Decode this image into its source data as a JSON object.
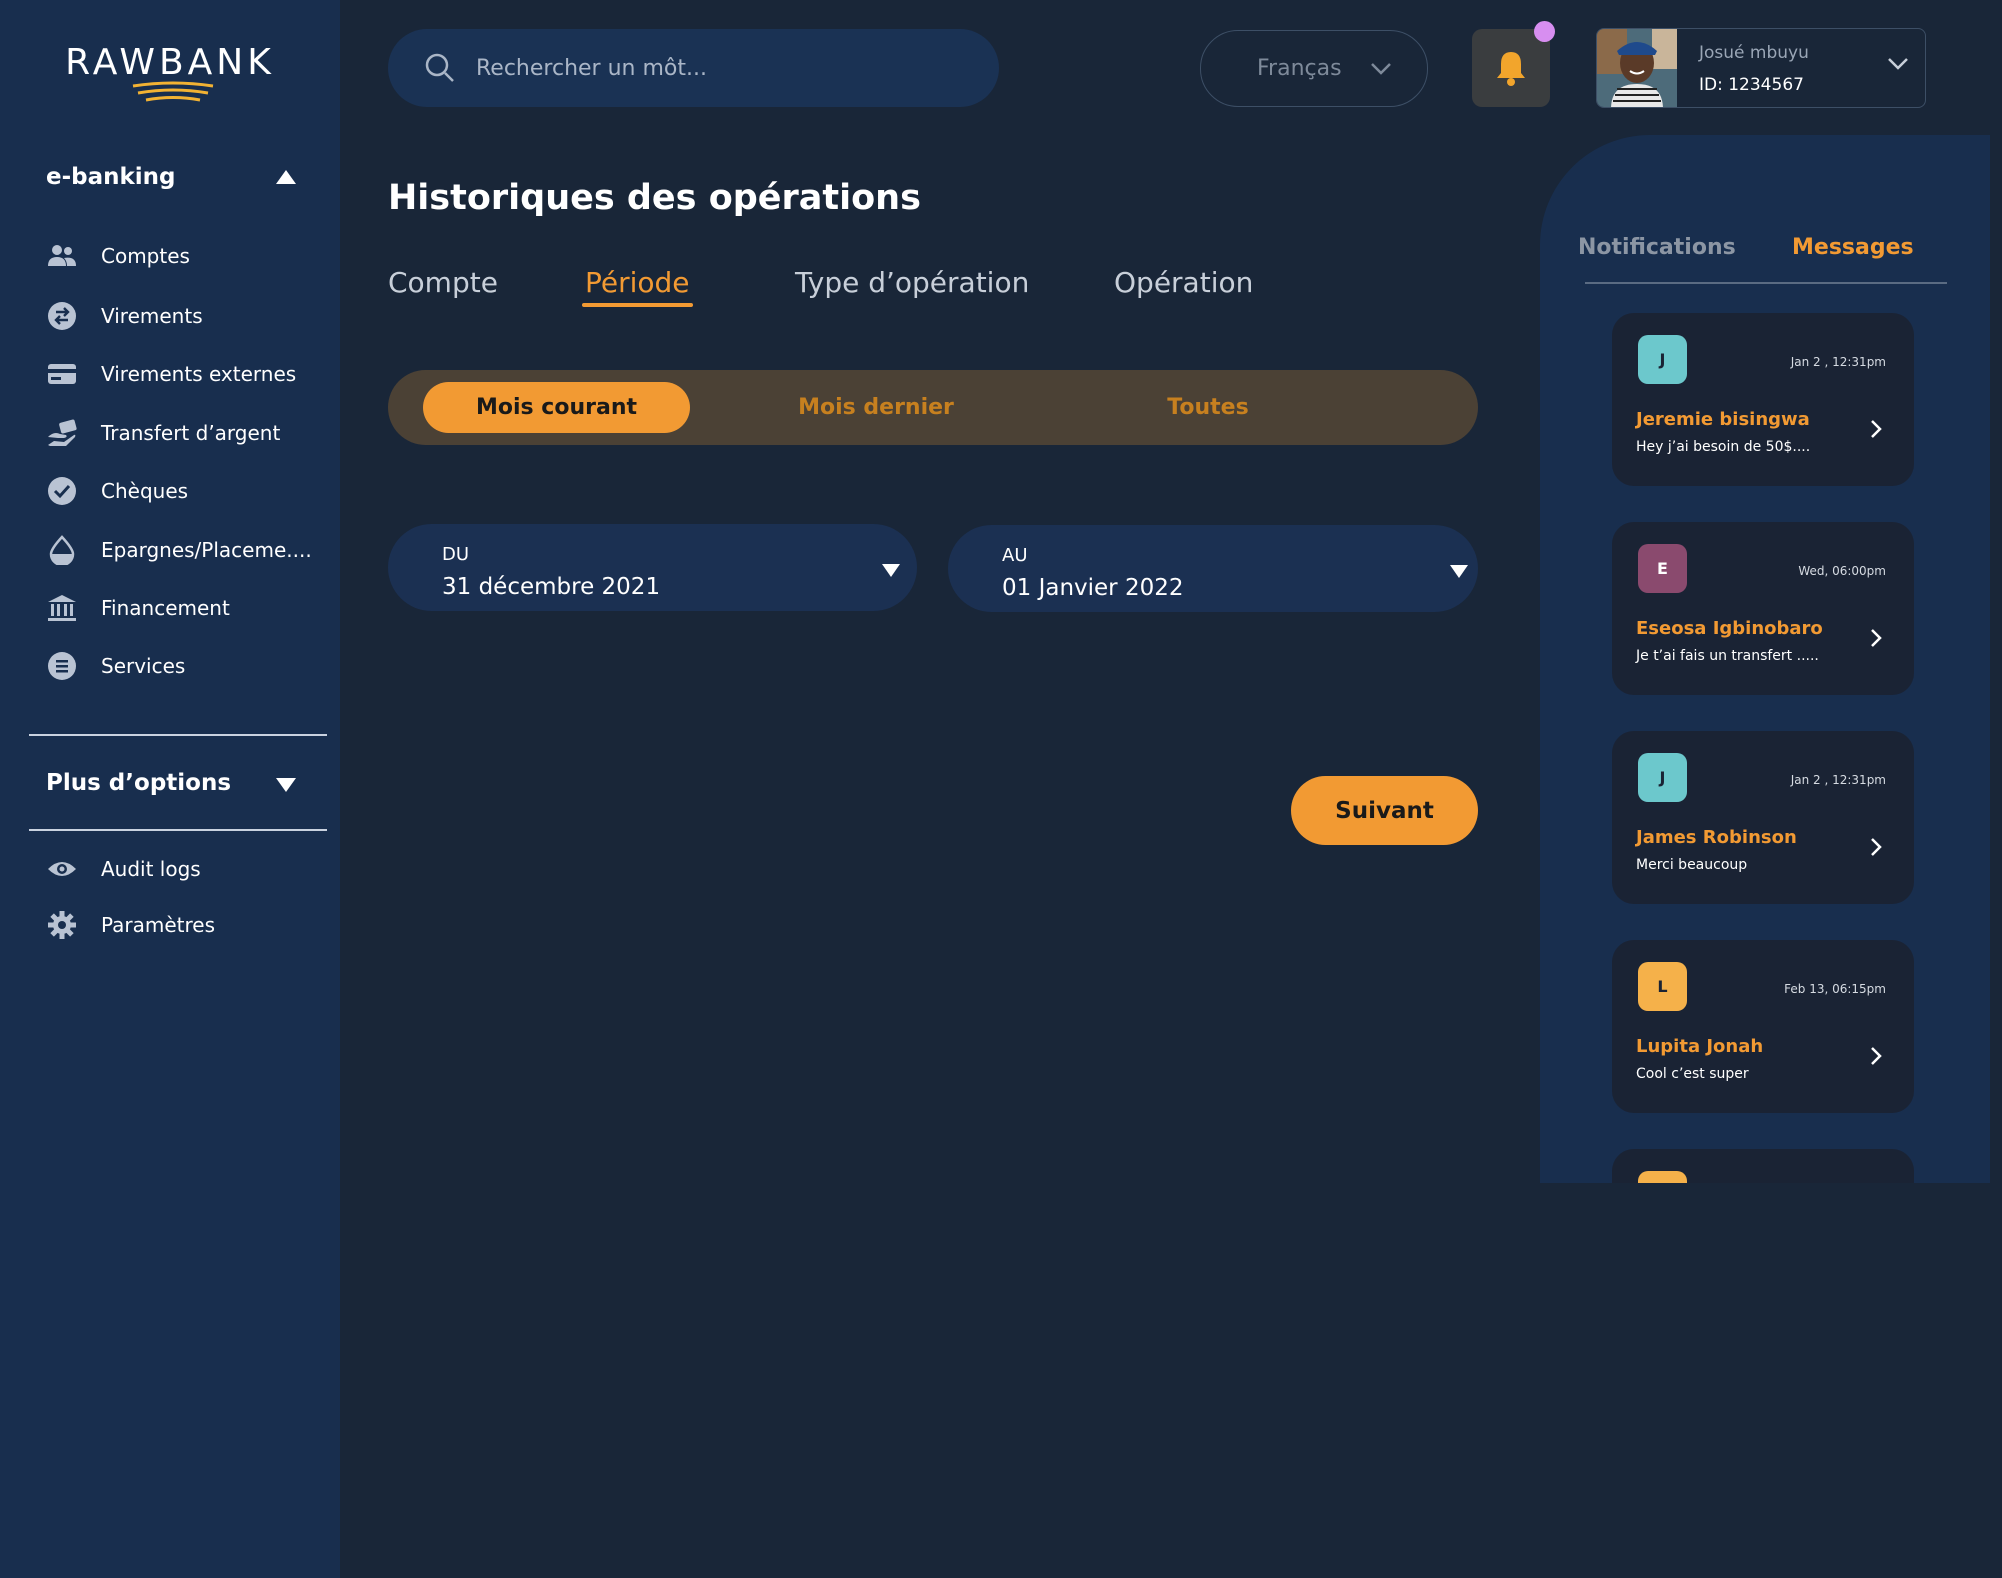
{
  "brand": {
    "name": "RAWBANK"
  },
  "sidebar": {
    "section_main": "e-banking",
    "items": [
      {
        "label": "Comptes",
        "icon": "users-icon"
      },
      {
        "label": "Virements",
        "icon": "transfer-icon"
      },
      {
        "label": "Virements externes",
        "icon": "credit-card-icon"
      },
      {
        "label": "Transfert d’argent",
        "icon": "money-hand-icon"
      },
      {
        "label": "Chèques",
        "icon": "check-circle-icon"
      },
      {
        "label": "Epargnes/Placeme....",
        "icon": "drop-icon"
      },
      {
        "label": "Financement",
        "icon": "bank-icon"
      },
      {
        "label": "Services",
        "icon": "list-icon"
      }
    ],
    "section_more": "Plus d’options",
    "more_items": [
      {
        "label": "Audit logs",
        "icon": "eye-icon"
      },
      {
        "label": "Paramètres",
        "icon": "gear-icon"
      }
    ]
  },
  "header": {
    "search_placeholder": "Rechercher un môt...",
    "language": "Franças",
    "user_name": "Josué mbuyu",
    "user_id": "ID: 1234567",
    "notification_dot_color": "#d78ef0"
  },
  "main": {
    "title": "Historiques des opérations",
    "tabs": [
      "Compte",
      "Période",
      "Type d’opération",
      "Opération"
    ],
    "active_tab": "Période",
    "period_options": [
      "Mois courant",
      "Mois dernier",
      "Toutes"
    ],
    "active_period": "Mois courant",
    "from_label": "DU",
    "from_value": "31 décembre 2021",
    "to_label": "AU",
    "to_value": "01 Janvier 2022",
    "next_button": "Suivant"
  },
  "right_panel": {
    "tabs": [
      "Notifications",
      "Messages"
    ],
    "active_tab": "Messages",
    "messages": [
      {
        "initial": "J",
        "time": "Jan 2 , 12:31pm",
        "name": "Jeremie bisingwa",
        "text": "Hey j’ai besoin de 50$....",
        "badge_color": "#6cc8cc"
      },
      {
        "initial": "E",
        "time": "Wed, 06:00pm",
        "name": "Eseosa Igbinobaro",
        "text": "Je t’ai fais un transfert .....",
        "badge_color": "#8a4a6e"
      },
      {
        "initial": "J",
        "time": "Jan 2 , 12:31pm",
        "name": "James Robinson",
        "text": "Merci beaucoup",
        "badge_color": "#6cc8cc"
      },
      {
        "initial": "L",
        "time": "Feb 13, 06:15pm",
        "name": "Lupita Jonah",
        "text": "Cool c’est super",
        "badge_color": "#f5b14a"
      }
    ]
  },
  "colors": {
    "accent": "#f29a33",
    "sidebar_bg": "#182e4e",
    "page_bg": "#192638"
  }
}
